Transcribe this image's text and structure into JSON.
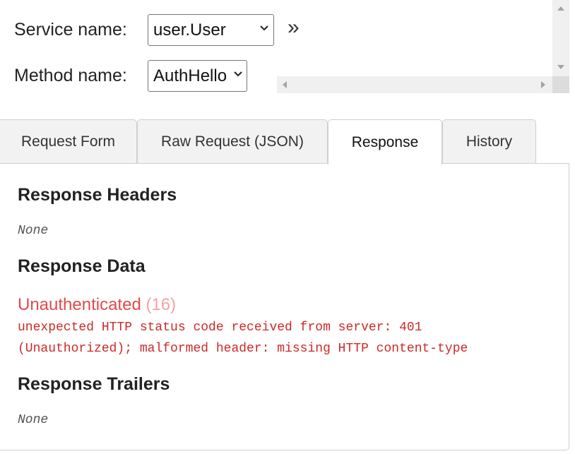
{
  "service": {
    "label": "Service name:",
    "selected": "user.User"
  },
  "method": {
    "label": "Method name:",
    "selected": "AuthHello"
  },
  "expand_glyph": "»",
  "tabs": [
    {
      "label": "Request Form",
      "active": false
    },
    {
      "label": "Raw Request (JSON)",
      "active": false
    },
    {
      "label": "Response",
      "active": true
    },
    {
      "label": "History",
      "active": false
    }
  ],
  "response": {
    "headers_title": "Response Headers",
    "headers_value": "None",
    "data_title": "Response Data",
    "error_status": "Unauthenticated",
    "error_code": "(16)",
    "error_message": "unexpected HTTP status code received from server: 401\n(Unauthorized); malformed header: missing HTTP content-type",
    "trailers_title": "Response Trailers",
    "trailers_value": "None"
  },
  "colors": {
    "error": "#e14a4a",
    "error_code": "#f4a3a3",
    "error_message": "#cc2a2a"
  }
}
